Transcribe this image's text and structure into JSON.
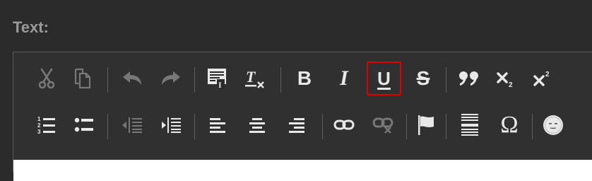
{
  "field": {
    "label": "Text:"
  },
  "toolbar": {
    "row1": [
      {
        "name": "cut-button",
        "icon": "scissors-icon",
        "enabled": false
      },
      {
        "name": "copy-button",
        "icon": "copy-icon",
        "enabled": false
      },
      {
        "name": "undo-button",
        "icon": "undo-icon",
        "enabled": false
      },
      {
        "name": "redo-button",
        "icon": "redo-icon",
        "enabled": false
      },
      {
        "name": "paste-text-button",
        "icon": "paste-text-icon",
        "enabled": true
      },
      {
        "name": "remove-format-button",
        "icon": "remove-format-icon",
        "enabled": true
      },
      {
        "name": "bold-button",
        "icon": "bold-icon",
        "glyph": "B",
        "enabled": true
      },
      {
        "name": "italic-button",
        "icon": "italic-icon",
        "glyph": "I",
        "enabled": true
      },
      {
        "name": "underline-button",
        "icon": "underline-icon",
        "glyph": "U",
        "enabled": true,
        "active": true
      },
      {
        "name": "strikethrough-button",
        "icon": "strikethrough-icon",
        "glyph": "S",
        "enabled": true
      },
      {
        "name": "blockquote-button",
        "icon": "quote-icon",
        "enabled": true
      },
      {
        "name": "subscript-button",
        "icon": "subscript-icon",
        "enabled": true
      },
      {
        "name": "superscript-button",
        "icon": "superscript-icon",
        "enabled": true
      }
    ],
    "row2": [
      {
        "name": "numbered-list-button",
        "icon": "numbered-list-icon",
        "enabled": true
      },
      {
        "name": "bulleted-list-button",
        "icon": "bulleted-list-icon",
        "enabled": true
      },
      {
        "name": "outdent-button",
        "icon": "outdent-icon",
        "enabled": false
      },
      {
        "name": "indent-button",
        "icon": "indent-icon",
        "enabled": true
      },
      {
        "name": "align-left-button",
        "icon": "align-left-icon",
        "enabled": true
      },
      {
        "name": "align-center-button",
        "icon": "align-center-icon",
        "enabled": true
      },
      {
        "name": "align-right-button",
        "icon": "align-right-icon",
        "enabled": true
      },
      {
        "name": "link-button",
        "icon": "link-icon",
        "enabled": true
      },
      {
        "name": "unlink-button",
        "icon": "unlink-icon",
        "enabled": false
      },
      {
        "name": "anchor-button",
        "icon": "flag-icon",
        "enabled": true
      },
      {
        "name": "horizontal-line-button",
        "icon": "horizontal-line-icon",
        "enabled": true
      },
      {
        "name": "special-char-button",
        "icon": "omega-icon",
        "glyph": "Ω",
        "enabled": true
      },
      {
        "name": "emoji-button",
        "icon": "smiley-icon",
        "enabled": true
      }
    ]
  },
  "colors": {
    "background": "#2b2b2c",
    "icon_enabled": "#e8e8e8",
    "icon_disabled": "#777777",
    "active_border": "#e00000",
    "label": "#9a9a9a"
  }
}
